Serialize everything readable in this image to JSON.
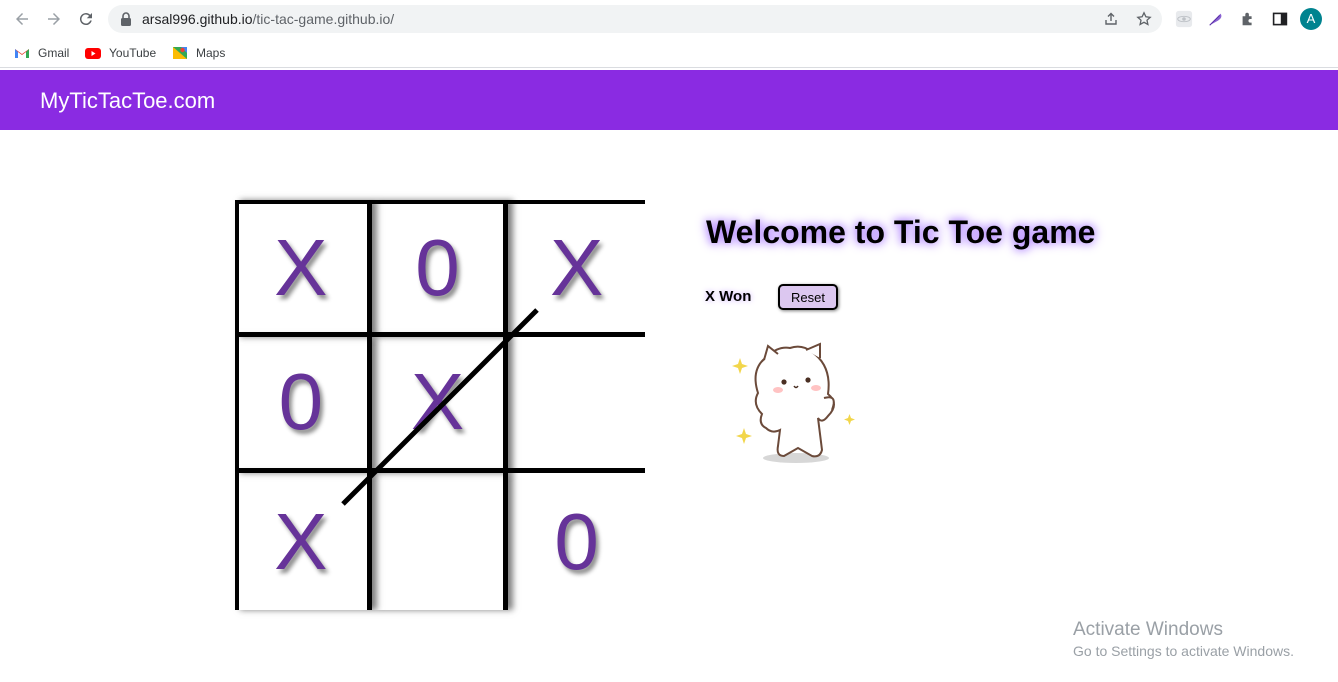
{
  "browser": {
    "url_host": "arsal996.github.io",
    "url_path": "/tic-tac-game.github.io/",
    "profile_initial": "A",
    "bookmarks": [
      {
        "label": "Gmail",
        "icon": "gmail-icon"
      },
      {
        "label": "YouTube",
        "icon": "youtube-icon"
      },
      {
        "label": "Maps",
        "icon": "maps-icon"
      }
    ]
  },
  "site": {
    "brand": "MyTicTacToe.com",
    "accent_color": "#8a2be2"
  },
  "game": {
    "title": "Welcome to Tic Toe game",
    "status": "X Won",
    "reset_label": "Reset",
    "board": [
      "X",
      "0",
      "X",
      "0",
      "X",
      "",
      "X",
      "",
      "0"
    ],
    "winning_line": "anti-diagonal",
    "mark_color": "#663399"
  },
  "watermark": {
    "line1": "Activate Windows",
    "line2": "Go to Settings to activate Windows."
  }
}
